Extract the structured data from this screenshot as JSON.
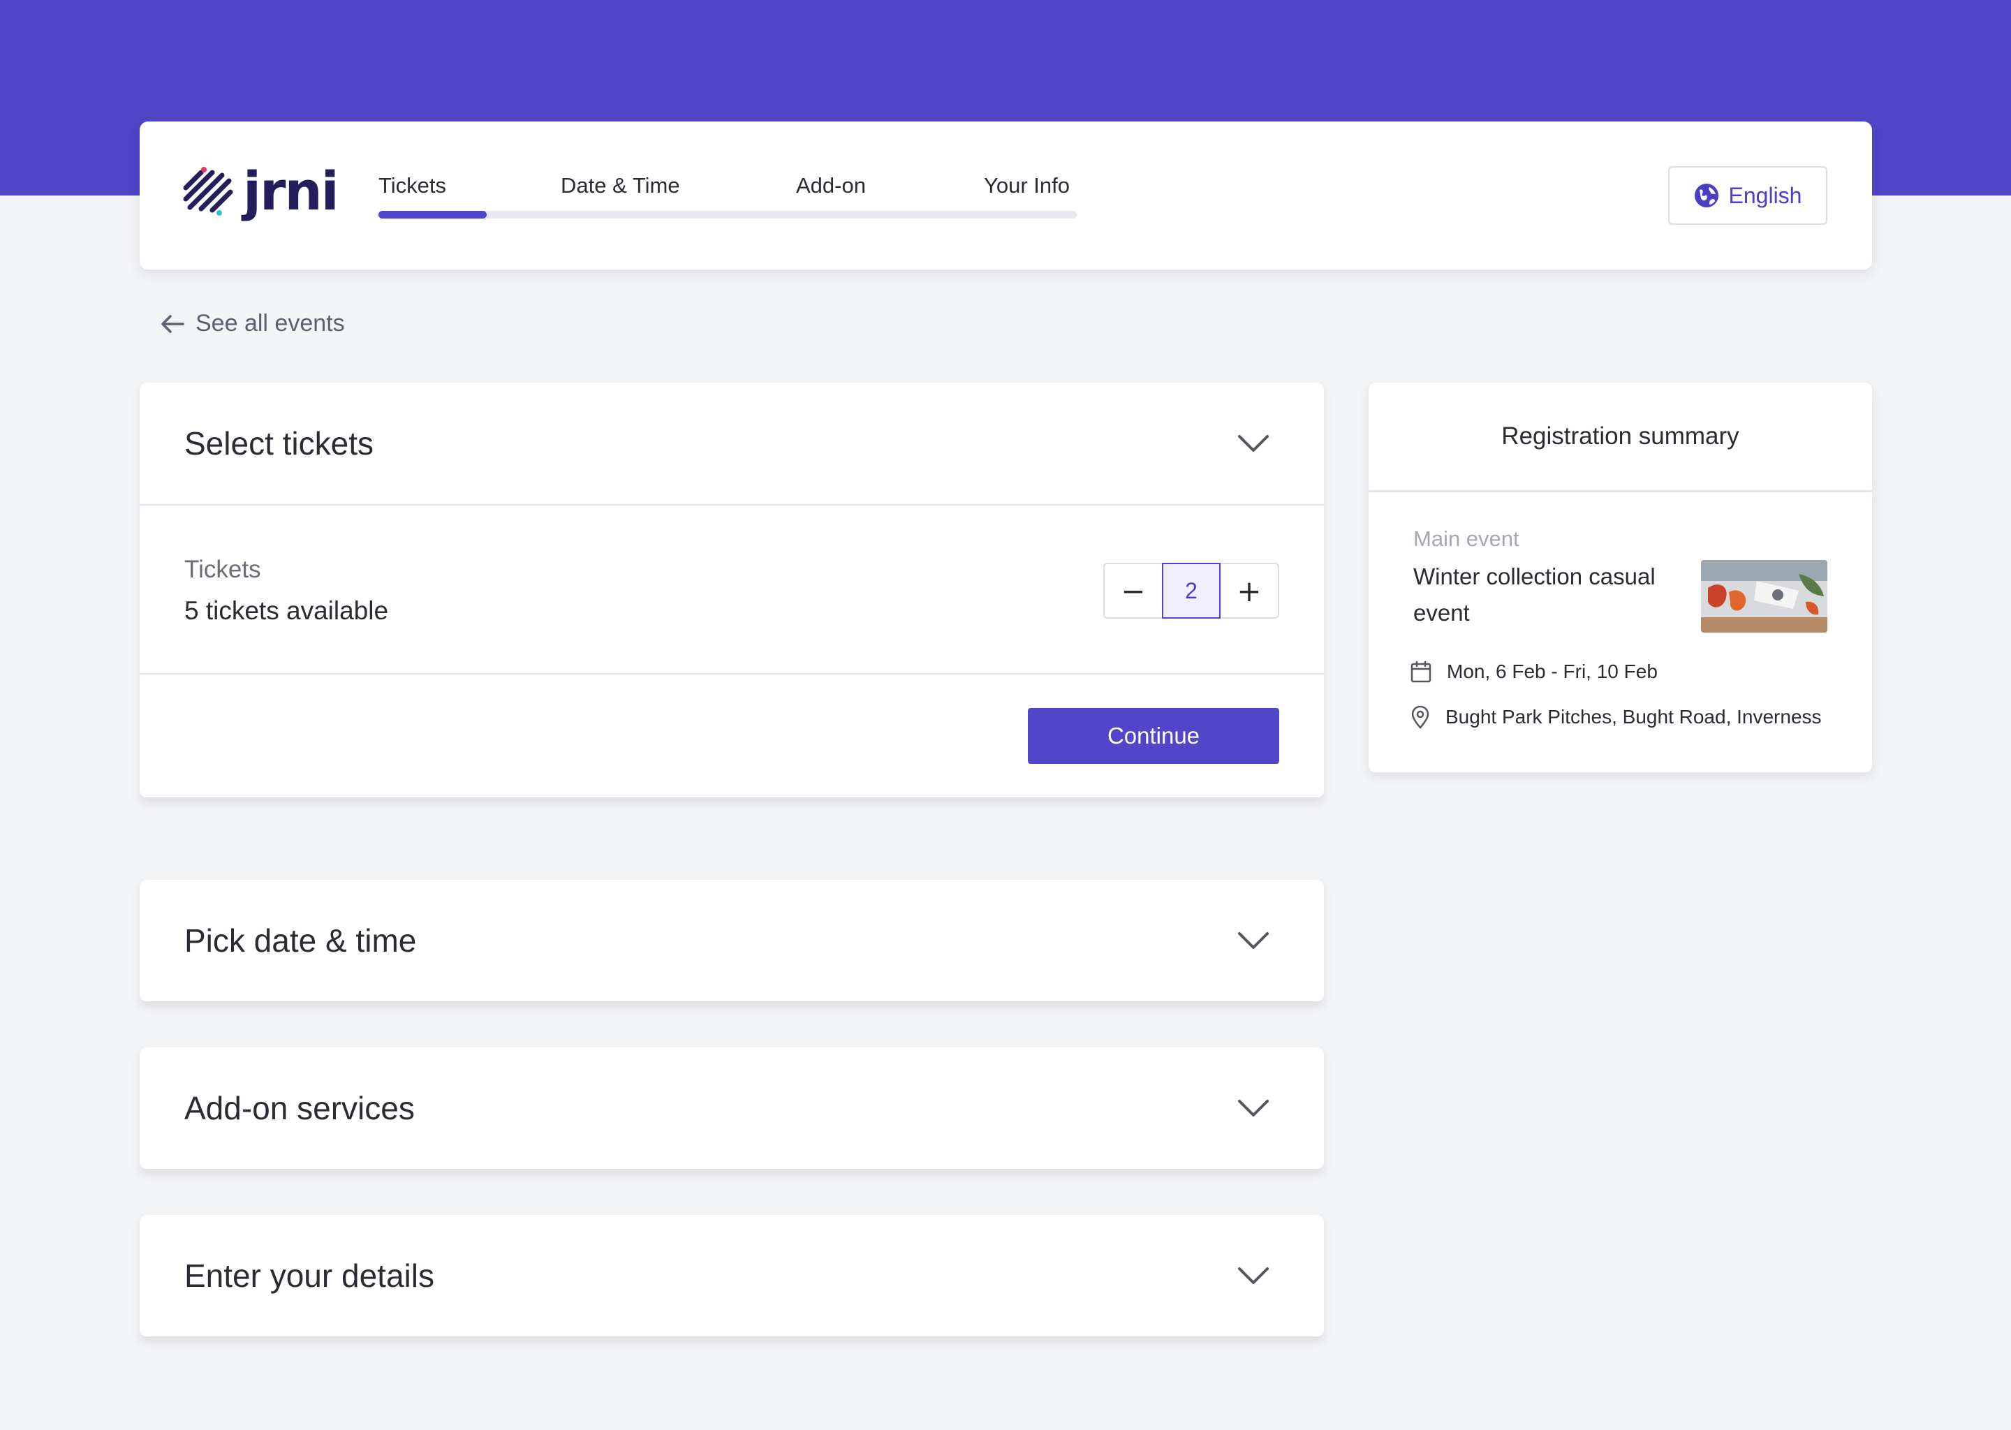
{
  "brand": {
    "name": "jrni",
    "accent": "#5145c8"
  },
  "steps": [
    {
      "label": "Tickets"
    },
    {
      "label": "Date & Time"
    },
    {
      "label": "Add-on"
    },
    {
      "label": "Your Info"
    }
  ],
  "progress": {
    "completed_fraction": 0.155
  },
  "language": {
    "label": "English",
    "icon": "globe-icon"
  },
  "back_link": {
    "label": "See all events",
    "icon": "arrow-left-icon"
  },
  "sections": {
    "tickets": {
      "title": "Select tickets",
      "label": "Tickets",
      "availability": "5 tickets available",
      "quantity": "2",
      "decrement": "−",
      "increment": "+",
      "continue_label": "Continue"
    },
    "date_time": {
      "title": "Pick date & time"
    },
    "addons": {
      "title": "Add-on services"
    },
    "details": {
      "title": "Enter your details"
    }
  },
  "summary": {
    "title": "Registration summary",
    "label": "Main event",
    "event_name": "Winter collection casual event",
    "dates": "Mon, 6 Feb - Fri, 10 Feb",
    "location": "Bught Park Pitches, Bught Road, Inverness"
  }
}
